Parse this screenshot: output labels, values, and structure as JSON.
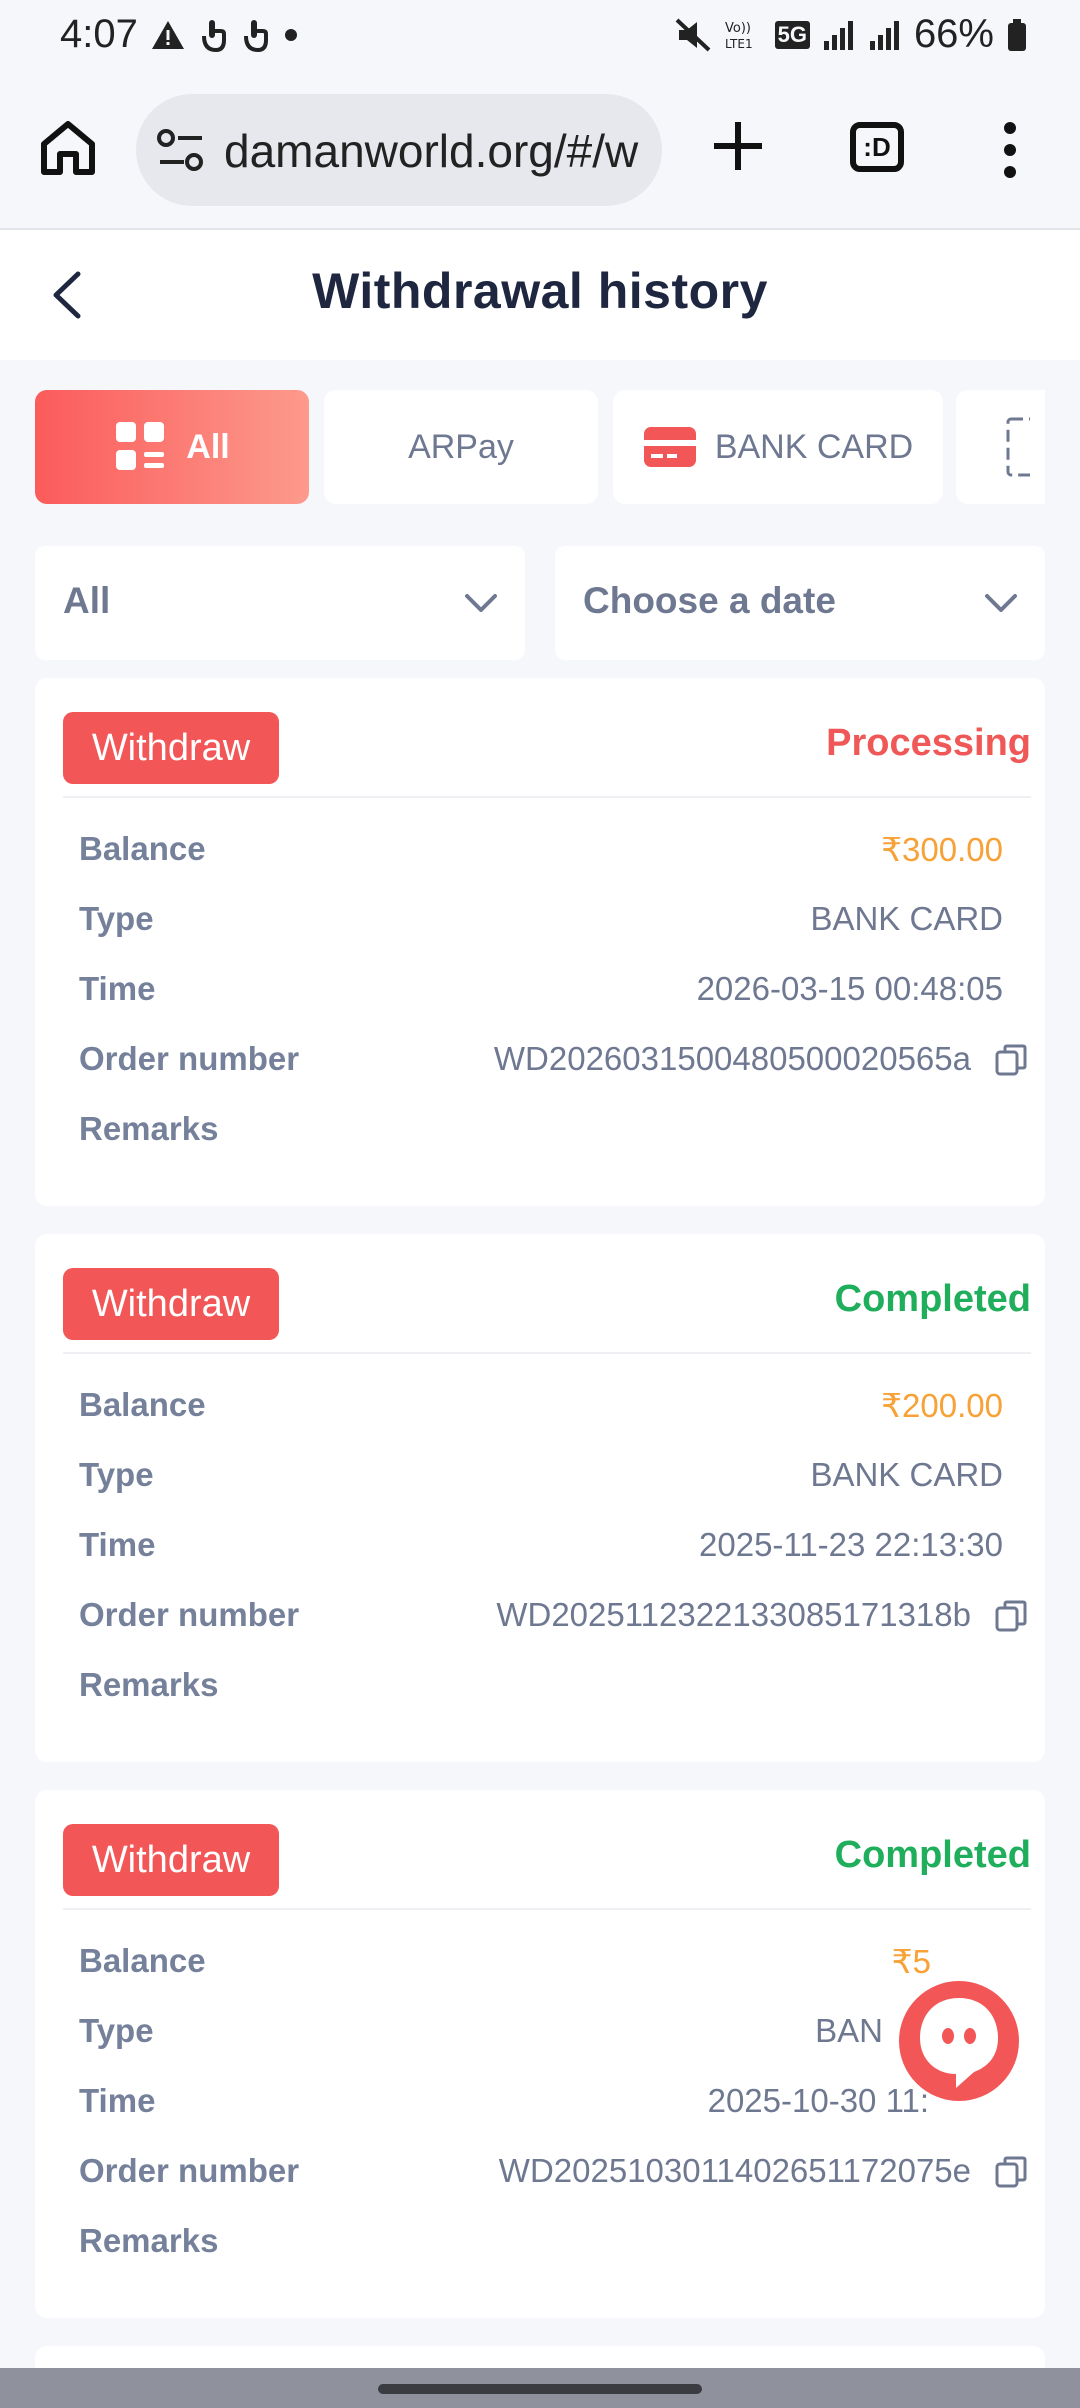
{
  "status_bar": {
    "time": "4:07",
    "network": "5G",
    "battery": "66%"
  },
  "browser": {
    "url": "damanworld.org/#/w",
    "tabs_count": ":D"
  },
  "header": {
    "title": "Withdrawal history"
  },
  "tabs": [
    {
      "label": "All",
      "icon": "grid-list-icon",
      "active": true
    },
    {
      "label": "ARPay",
      "icon": "",
      "active": false
    },
    {
      "label": "BANK CARD",
      "icon": "bank-card-icon",
      "active": false
    },
    {
      "label": "",
      "icon": "partial-tab-icon",
      "active": false
    }
  ],
  "filters": {
    "type": "All",
    "date": "Choose a date"
  },
  "labels": {
    "balance": "Balance",
    "type": "Type",
    "time": "Time",
    "order_number": "Order number",
    "remarks": "Remarks"
  },
  "records": [
    {
      "badge": "Withdraw",
      "status": "Processing",
      "balance": "₹300.00",
      "type": "BANK CARD",
      "time": "2026-03-15 00:48:05",
      "order_number": "WD2026031500480500020565a",
      "remarks": ""
    },
    {
      "badge": "Withdraw",
      "status": "Completed",
      "balance": "₹200.00",
      "type": "BANK CARD",
      "time": "2025-11-23 22:13:30",
      "order_number": "WD2025112322133085171318b",
      "remarks": ""
    },
    {
      "badge": "Withdraw",
      "status": "Completed",
      "balance": "₹5",
      "type": "BAN",
      "time": "2025-10-30 11:",
      "order_number": "WD2025103011402651172075e",
      "remarks": ""
    }
  ],
  "colors": {
    "accent": "#f25656",
    "processing": "#f05757",
    "completed": "#1fae5b",
    "amount": "#f7a136"
  }
}
